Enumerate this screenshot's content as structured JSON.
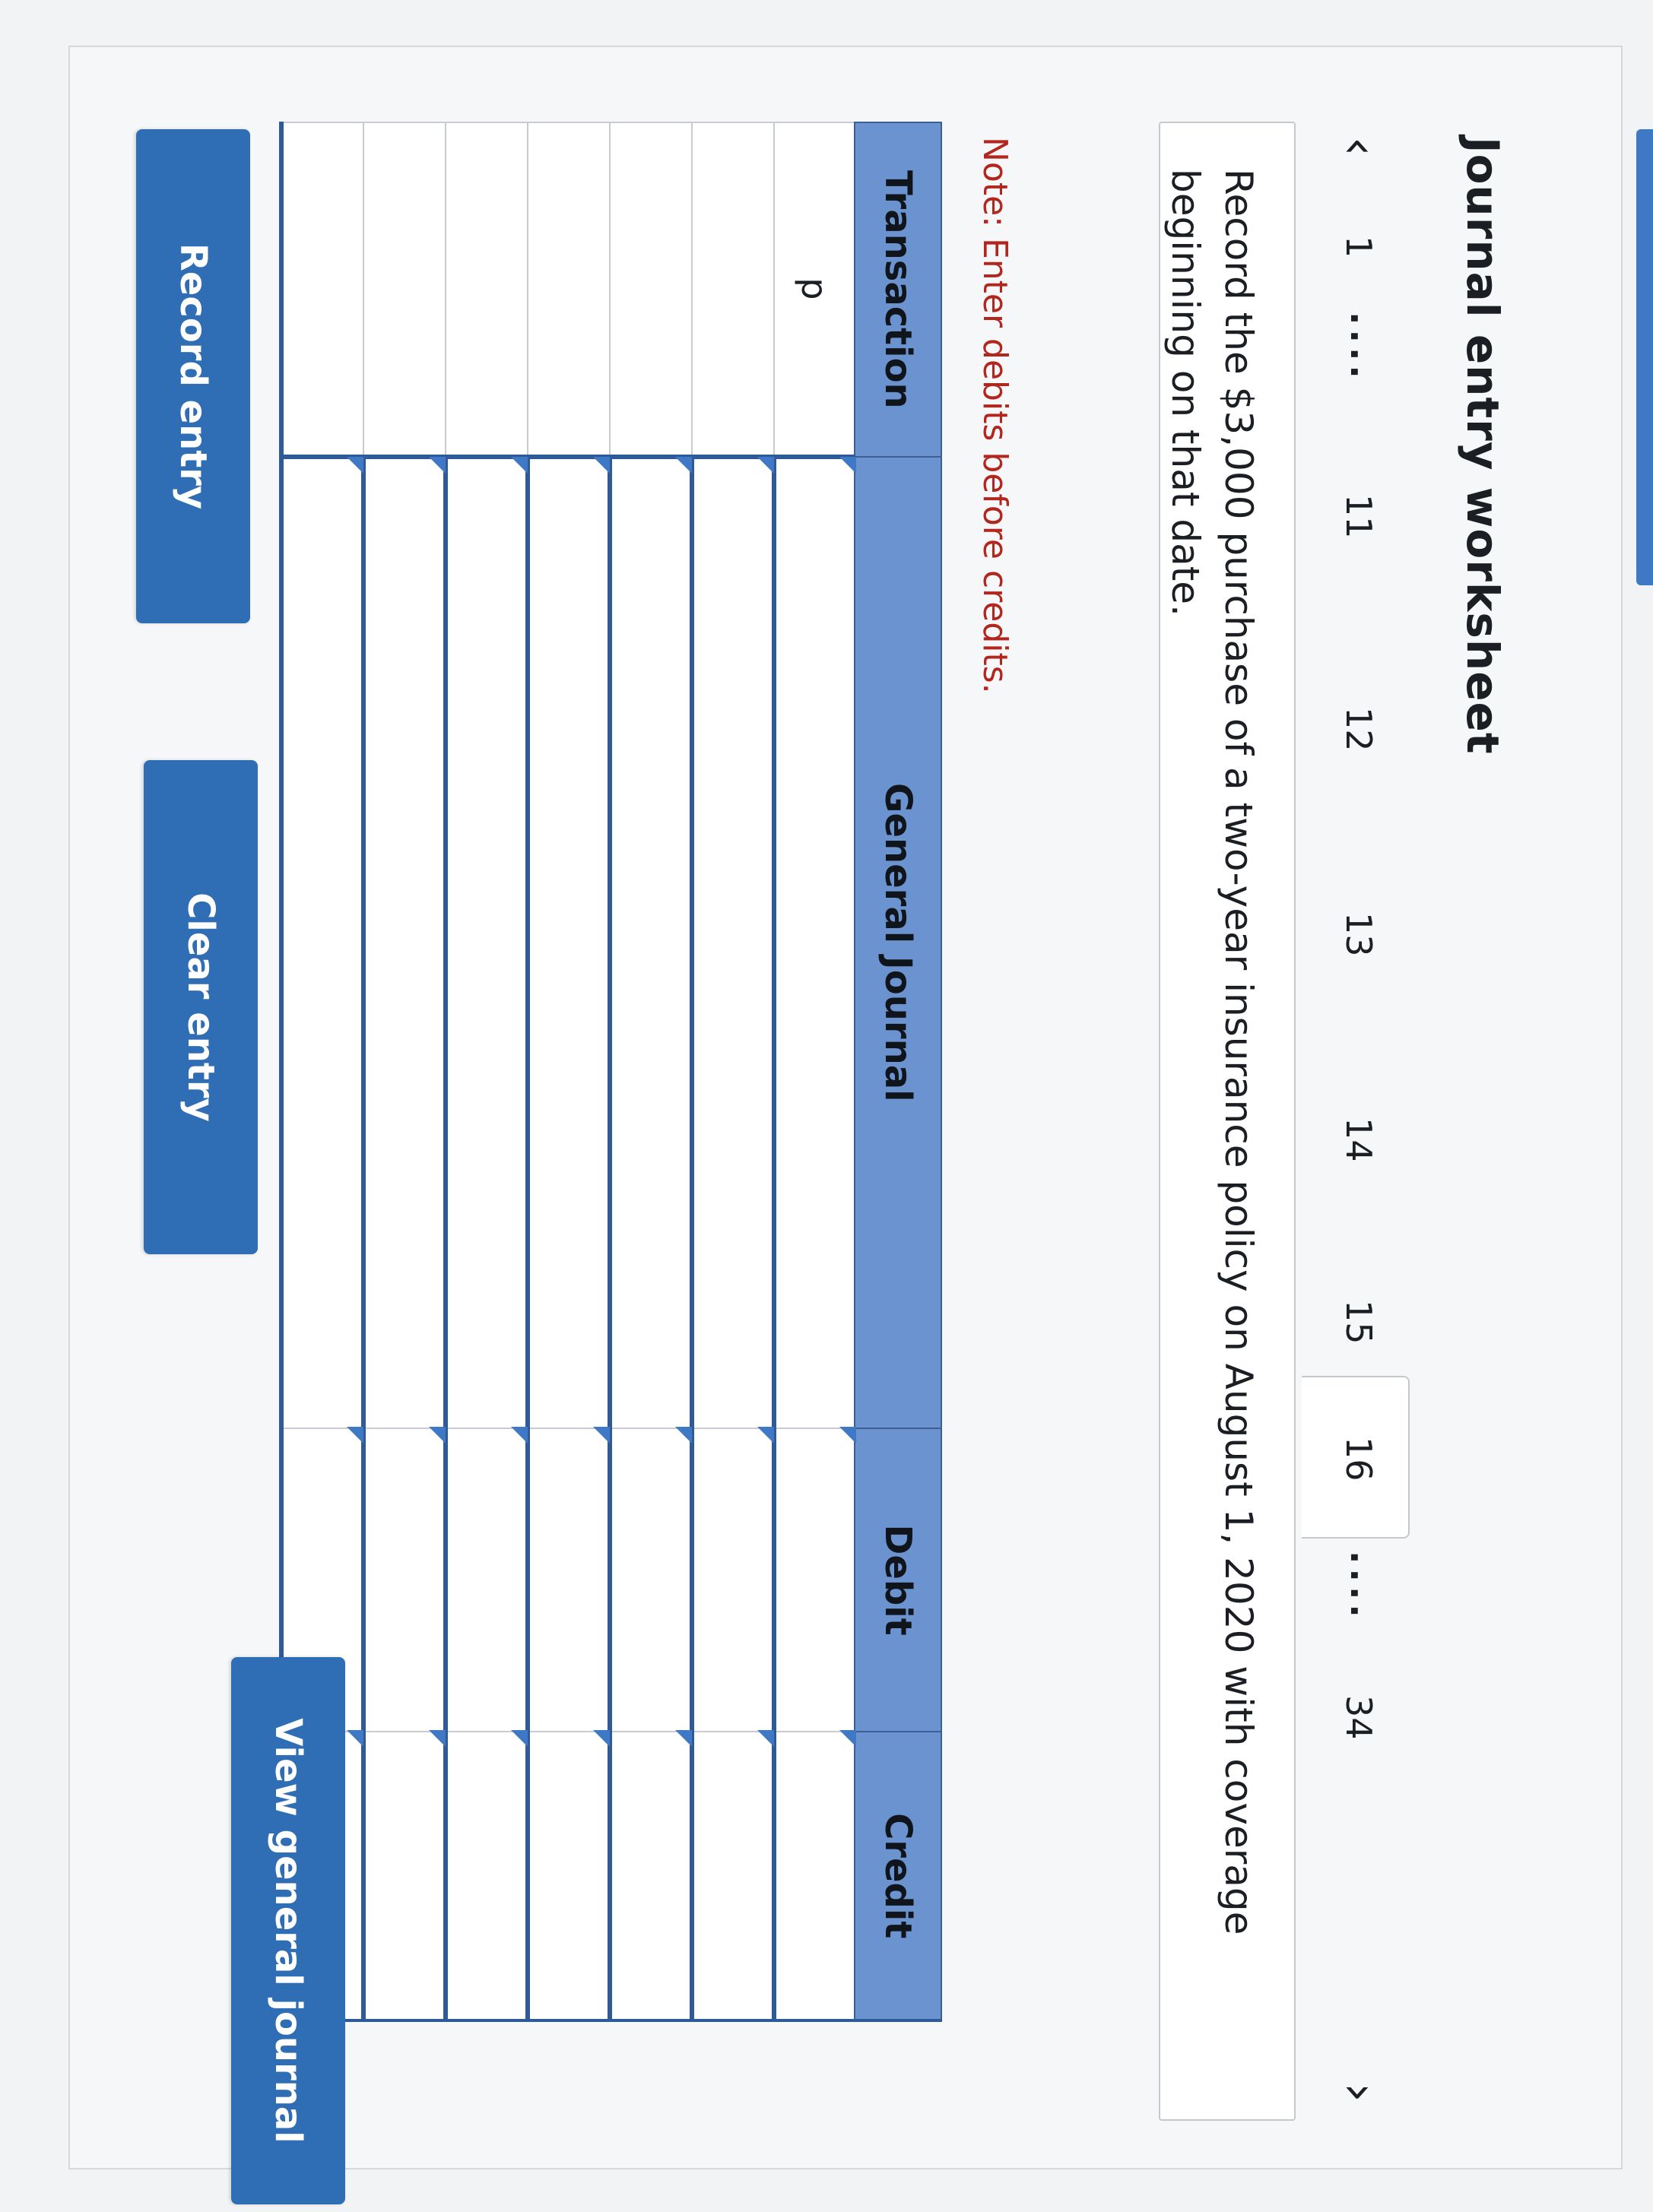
{
  "header": {
    "title": "Journal entry worksheet"
  },
  "nav": {
    "prev_icon": "chevron-left-icon",
    "next_icon": "chevron-right-icon",
    "items": [
      "1",
      "11",
      "12",
      "13",
      "14",
      "15",
      "16",
      "34"
    ],
    "ellipsis": "....",
    "active": "16"
  },
  "question": {
    "text": "Record the $3,000 purchase of a two-year insurance policy on August 1, 2020 with coverage beginning on that date."
  },
  "note": {
    "text": "Note: Enter debits before credits."
  },
  "journal": {
    "columns": [
      "Transaction",
      "General Journal",
      "Debit",
      "Credit"
    ],
    "rows": [
      {
        "transaction": "p",
        "account": "",
        "debit": "",
        "credit": ""
      },
      {
        "transaction": "",
        "account": "",
        "debit": "",
        "credit": ""
      },
      {
        "transaction": "",
        "account": "",
        "debit": "",
        "credit": ""
      },
      {
        "transaction": "",
        "account": "",
        "debit": "",
        "credit": ""
      },
      {
        "transaction": "",
        "account": "",
        "debit": "",
        "credit": ""
      },
      {
        "transaction": "",
        "account": "",
        "debit": "",
        "credit": ""
      },
      {
        "transaction": "",
        "account": "",
        "debit": "",
        "credit": ""
      }
    ]
  },
  "buttons": {
    "record": "Record entry",
    "clear": "Clear entry",
    "view": "View general journal"
  },
  "colors": {
    "header_blue": "#6b93cf",
    "button_blue": "#2f6db5",
    "note_red": "#b3261e"
  }
}
